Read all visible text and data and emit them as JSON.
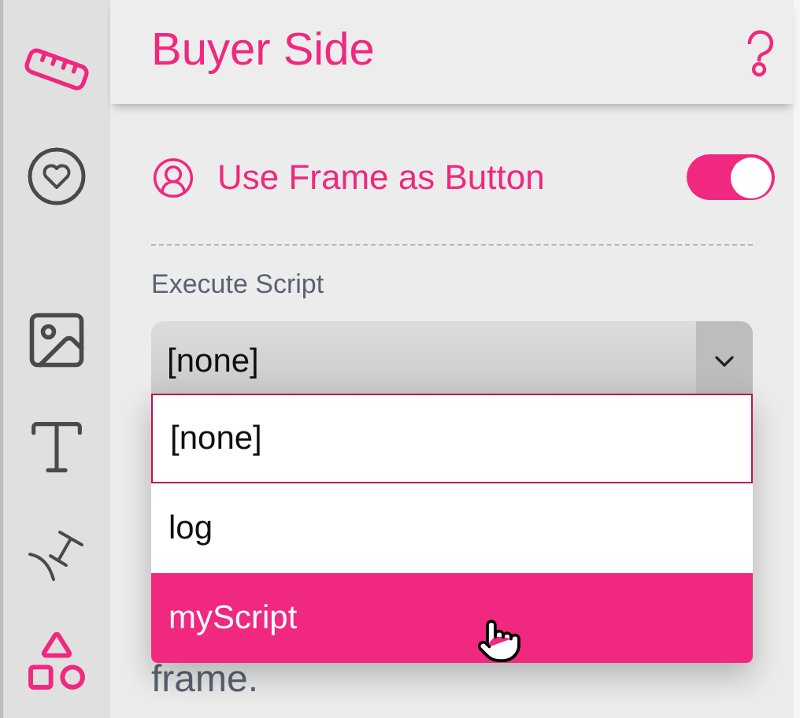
{
  "sidebar": {
    "items": [
      {
        "kind": "ruler",
        "selected": true
      },
      {
        "kind": "badge",
        "selected": false
      },
      {
        "kind": "image",
        "selected": false
      },
      {
        "kind": "text",
        "selected": false
      },
      {
        "kind": "curve",
        "selected": false
      },
      {
        "kind": "shapes",
        "selected": true
      }
    ]
  },
  "panel": {
    "title": "Buyer Side"
  },
  "toggle_row": {
    "label": "Use Frame as Button",
    "on": true
  },
  "script": {
    "label": "Execute Script",
    "value": "[none]",
    "expanded": true,
    "options": [
      {
        "label": "[none]",
        "selected": true,
        "highlighted": false
      },
      {
        "label": "log",
        "selected": false,
        "highlighted": false
      },
      {
        "label": "myScript",
        "selected": false,
        "highlighted": true
      }
    ]
  },
  "description": {
    "text": "frame."
  }
}
